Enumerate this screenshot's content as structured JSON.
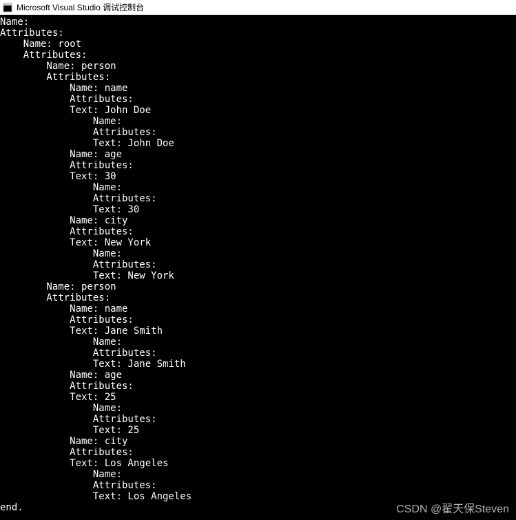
{
  "window": {
    "title": "Microsoft Visual Studio 调试控制台"
  },
  "console": {
    "lines": [
      "Name:",
      "Attributes:",
      "    Name: root",
      "    Attributes:",
      "        Name: person",
      "        Attributes:",
      "            Name: name",
      "            Attributes:",
      "            Text: John Doe",
      "                Name:",
      "                Attributes:",
      "                Text: John Doe",
      "            Name: age",
      "            Attributes:",
      "            Text: 30",
      "                Name:",
      "                Attributes:",
      "                Text: 30",
      "            Name: city",
      "            Attributes:",
      "            Text: New York",
      "                Name:",
      "                Attributes:",
      "                Text: New York",
      "        Name: person",
      "        Attributes:",
      "            Name: name",
      "            Attributes:",
      "            Text: Jane Smith",
      "                Name:",
      "                Attributes:",
      "                Text: Jane Smith",
      "            Name: age",
      "            Attributes:",
      "            Text: 25",
      "                Name:",
      "                Attributes:",
      "                Text: 25",
      "            Name: city",
      "            Attributes:",
      "            Text: Los Angeles",
      "                Name:",
      "                Attributes:",
      "                Text: Los Angeles",
      "end."
    ]
  },
  "watermark": {
    "text": "CSDN @翟天保Steven"
  },
  "tree_data": {
    "root_name": "",
    "root_attributes": "",
    "children": [
      {
        "name": "root",
        "attributes": "",
        "children": [
          {
            "name": "person",
            "attributes": "",
            "children": [
              {
                "name": "name",
                "attributes": "",
                "text": "John Doe",
                "inner": {
                  "name": "",
                  "attributes": "",
                  "text": "John Doe"
                }
              },
              {
                "name": "age",
                "attributes": "",
                "text": "30",
                "inner": {
                  "name": "",
                  "attributes": "",
                  "text": "30"
                }
              },
              {
                "name": "city",
                "attributes": "",
                "text": "New York",
                "inner": {
                  "name": "",
                  "attributes": "",
                  "text": "New York"
                }
              }
            ]
          },
          {
            "name": "person",
            "attributes": "",
            "children": [
              {
                "name": "name",
                "attributes": "",
                "text": "Jane Smith",
                "inner": {
                  "name": "",
                  "attributes": "",
                  "text": "Jane Smith"
                }
              },
              {
                "name": "age",
                "attributes": "",
                "text": "25",
                "inner": {
                  "name": "",
                  "attributes": "",
                  "text": "25"
                }
              },
              {
                "name": "city",
                "attributes": "",
                "text": "Los Angeles",
                "inner": {
                  "name": "",
                  "attributes": "",
                  "text": "Los Angeles"
                }
              }
            ]
          }
        ]
      }
    ],
    "terminator": "end."
  }
}
